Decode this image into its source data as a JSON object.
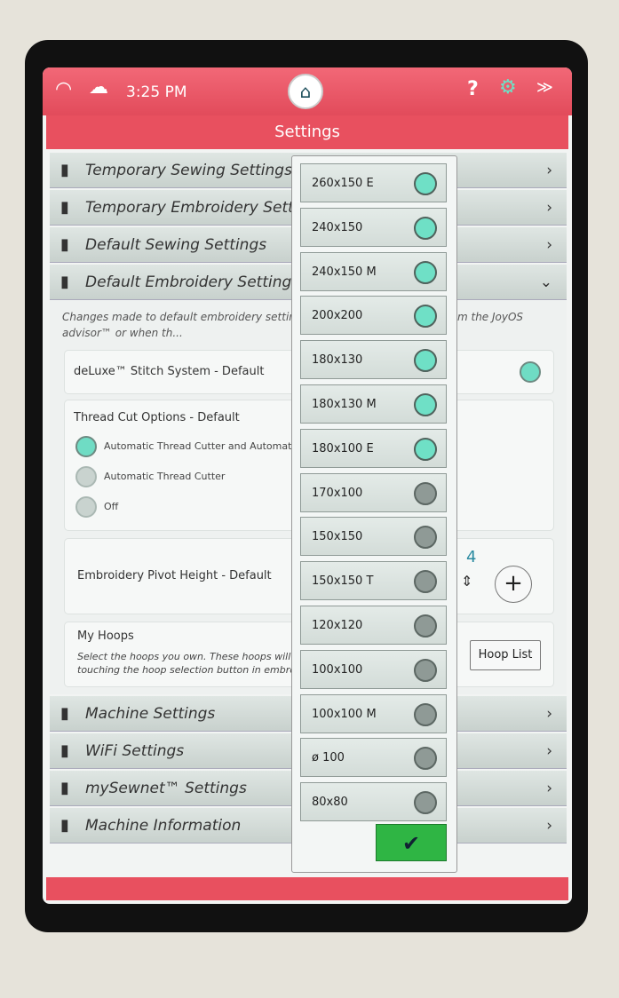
{
  "status": {
    "time": "3:25 PM",
    "icons": [
      "wifi-icon",
      "cloud-icon",
      "help-icon",
      "gear-icon",
      "bobbin-icon"
    ]
  },
  "title": "Settings",
  "rows_top": [
    {
      "label": "Temporary Sewing Settings",
      "icon": "sewing-temp-icon",
      "chevron": "›"
    },
    {
      "label": "Temporary Embroidery Settings",
      "icon": "embroidery-temp-icon",
      "chevron": "›"
    },
    {
      "label": "Default Sewing Settings",
      "icon": "sewing-default-icon",
      "chevron": "›"
    },
    {
      "label": "Default Embroidery Settings",
      "icon": "embroidery-default-icon",
      "chevron": "⌄"
    }
  ],
  "panel": {
    "note": "Changes made to default embroidery settings ... start of a new project from the JoyOS advisor™ or when th...",
    "deluxe": "deLuxe™ Stitch System - Default",
    "thread_cut": {
      "title": "Thread Cut Options - Default",
      "options": [
        {
          "label": "Automatic Thread Cutter and Automat...",
          "selected": true
        },
        {
          "label": "Automatic Thread Cutter",
          "selected": false
        },
        {
          "label": "Off",
          "selected": false
        }
      ]
    },
    "pivot": {
      "label": "Embroidery Pivot Height - Default",
      "value": "4",
      "plus": "+"
    },
    "hoops": {
      "title": "My Hoops",
      "desc1": "Select the hoops you own. These hoops will the...",
      "desc2": "touching the hoop selection button in embroide...",
      "button": "Hoop List"
    }
  },
  "rows_bottom": [
    {
      "label": "Machine Settings",
      "icon": "machine-icon",
      "chevron": "›"
    },
    {
      "label": "WiFi Settings",
      "icon": "wifi-icon",
      "chevron": "›"
    },
    {
      "label": "mySewnet™ Settings",
      "icon": "cloud-icon",
      "chevron": "›"
    },
    {
      "label": "Machine Information",
      "icon": "info-icon",
      "chevron": "›"
    }
  ],
  "hoop_list": [
    {
      "name": "260x150 E",
      "selected": true
    },
    {
      "name": "240x150",
      "selected": true
    },
    {
      "name": "240x150 M",
      "selected": true
    },
    {
      "name": "200x200",
      "selected": true
    },
    {
      "name": "180x130",
      "selected": true
    },
    {
      "name": "180x130 M",
      "selected": true
    },
    {
      "name": "180x100 E",
      "selected": true
    },
    {
      "name": "170x100",
      "selected": false
    },
    {
      "name": "150x150",
      "selected": false
    },
    {
      "name": "150x150 T",
      "selected": false
    },
    {
      "name": "120x120",
      "selected": false
    },
    {
      "name": "100x100",
      "selected": false
    },
    {
      "name": "100x100 M",
      "selected": false
    },
    {
      "name": "ø 100",
      "selected": false
    },
    {
      "name": "80x80",
      "selected": false
    }
  ],
  "ok": "✔",
  "colors": {
    "accent": "#e8505f",
    "selected": "#6fe0c6",
    "confirm": "#2fb544"
  }
}
